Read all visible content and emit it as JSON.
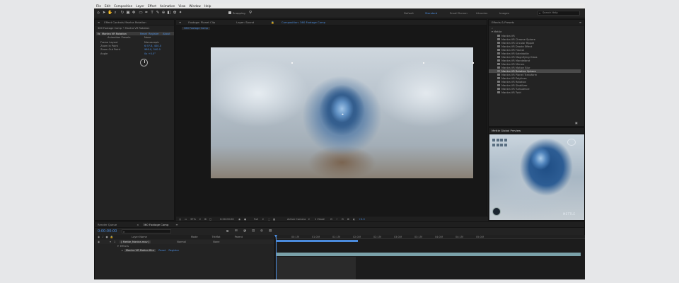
{
  "menu": [
    "File",
    "Edit",
    "Composition",
    "Layer",
    "Effect",
    "Animation",
    "View",
    "Window",
    "Help"
  ],
  "toolbar": {
    "snapping_label": "Snapping",
    "workspaces": [
      {
        "label": "Default",
        "active": false
      },
      {
        "label": "Standard",
        "active": true
      },
      {
        "label": "Small Screen",
        "active": false
      },
      {
        "label": "Libraries",
        "active": false
      },
      {
        "label": "Images",
        "active": false
      }
    ],
    "search_placeholder": "Search Help"
  },
  "effect_controls": {
    "tab_label": "Effect Controls Mantra Rotation",
    "path": "360 Footage Comp • Mantra VR Rotation",
    "effect_name": "Mantra VR Rotation",
    "reset_label": "Reset",
    "register_label": "Register",
    "about_label": "About",
    "properties": [
      {
        "label": "Animation Presets",
        "value": "None"
      },
      {
        "label": "Frame Layout",
        "value": "Monoscopic"
      },
      {
        "label": "Zoom In Point",
        "value": "6.97.8, 400.0"
      },
      {
        "label": "Zoom Out Point",
        "value": "960.0, 540.0"
      },
      {
        "label": "Angle",
        "value": "0x +0.0°"
      }
    ]
  },
  "tabs": {
    "footage": "Footage: Planet Clip",
    "layer": "Layer: Sound",
    "composition": "Composition: 360 Footage Comp",
    "comp_sub": "360 Footage Comp"
  },
  "viewer_bar": {
    "zoom": "37%",
    "timecode": "0:00:00:00",
    "resolution": "Full",
    "camera": "Active Camera",
    "views": "1 View",
    "offset": "+0.0"
  },
  "effects_presets": {
    "title": "Effects & Presets",
    "category": "Mettle",
    "items": [
      "Mantra VR",
      "Mantra VR Chrome Sphere",
      "Mantra VR Circular Ripple",
      "Mantra VR Droste Effect",
      "Mantra VR Fractal",
      "Mantra VR Kaleidotile",
      "Mantra VR Magnifying Glass",
      "Mantra VR Mandelbrot",
      "Mantra VR Mirrors",
      "Mantra VR Motion Blur",
      "Mantra VR Rotation Sphere",
      "Mantra VR Planet Transform",
      "Mantra VR Polylines",
      "Mantra VR Rotation",
      "Mantra VR Stabilizer",
      "Mantra VR Turbulence",
      "Mantra VR Twirl"
    ],
    "selected_index": 10
  },
  "mettle_preview": {
    "title": "Mettle Global Preview",
    "watermark": "METTLE"
  },
  "timeline": {
    "tab_render": "Render Queue",
    "tab_comp": "360 Footage Comp",
    "timecode": "0:00:00:00",
    "col_layer": "Layer Name",
    "col_mode": "Mode",
    "col_trkmat": "TrkMat",
    "col_parent": "Parent",
    "layer_num": "1",
    "layer_name": "[ Mettle_Mantra.mov ]",
    "layer_mode": "Normal",
    "layer_parent": "None",
    "effects_label": "Effects",
    "effect_row": "Mantra VR Motion Blur",
    "reset_label": "Reset",
    "register_label": "Register",
    "ticks": [
      "00:15f",
      "01:00f",
      "01:15f",
      "02:00f",
      "02:15f",
      "03:00f",
      "03:15f",
      "04:00f",
      "04:15f",
      "05:00f"
    ]
  }
}
